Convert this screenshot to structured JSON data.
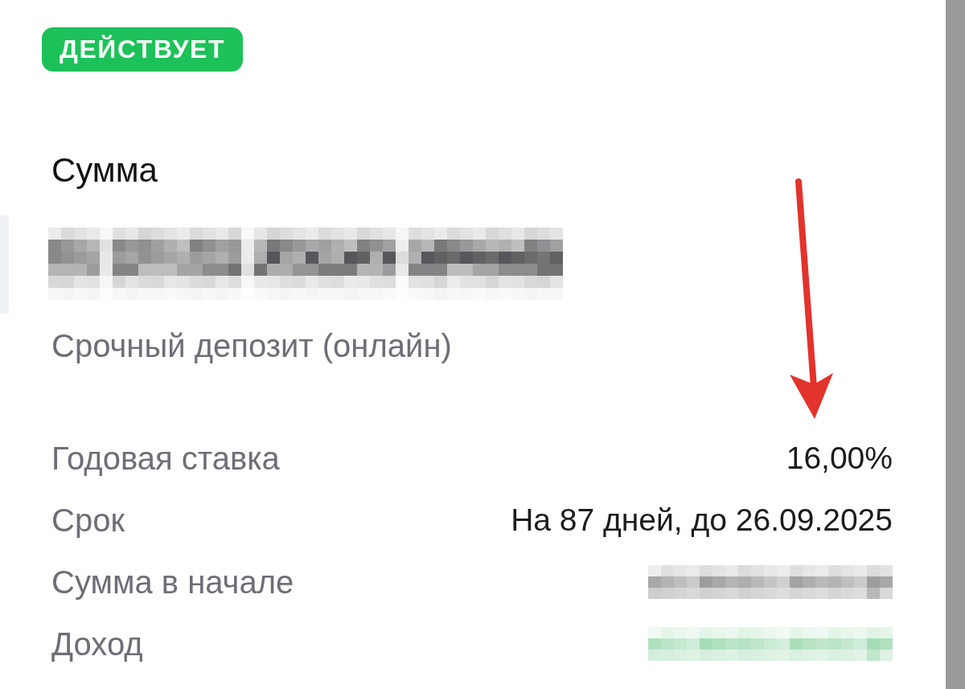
{
  "status_badge": {
    "label": "ДЕЙСТВУЕТ",
    "kind": "active"
  },
  "amount": {
    "label": "Сумма",
    "kind": "redacted"
  },
  "product_name": "Срочный депозит (онлайн)",
  "details": [
    {
      "label": "Годовая ставка",
      "kind": "text",
      "value": "16,00%",
      "marked": true
    },
    {
      "label": "Срок",
      "kind": "text",
      "value": "На 87 дней, до 26.09.2025",
      "marked": false
    },
    {
      "label": "Сумма в начале",
      "kind": "redacted",
      "positive": false,
      "marked": false
    },
    {
      "label": "Доход",
      "kind": "redacted",
      "positive": true,
      "marked": false
    }
  ]
}
